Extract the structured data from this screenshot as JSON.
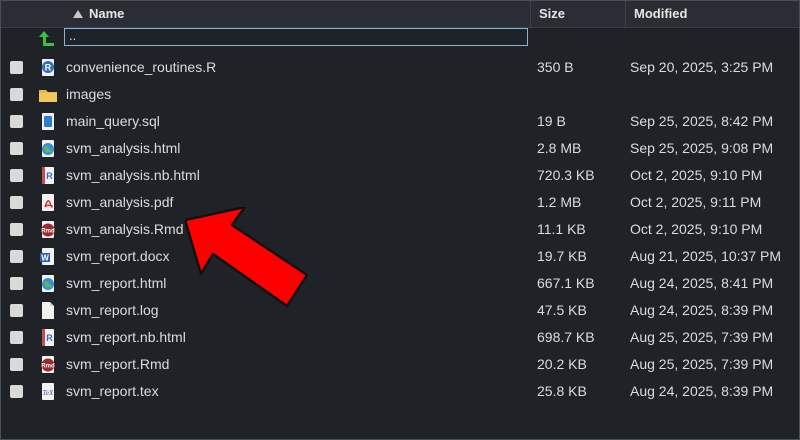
{
  "columns": {
    "name": "Name",
    "size": "Size",
    "modified": "Modified"
  },
  "parent_row": {
    "name": "..",
    "icon": "up-arrow-icon"
  },
  "files": [
    {
      "name": "convenience_routines.R",
      "size": "350 B",
      "modified": "Sep 20, 2025, 3:25 PM",
      "icon": "r-script-icon"
    },
    {
      "name": "images",
      "size": "",
      "modified": "",
      "icon": "folder-icon"
    },
    {
      "name": "main_query.sql",
      "size": "19 B",
      "modified": "Sep 25, 2025, 8:42 PM",
      "icon": "sql-file-icon"
    },
    {
      "name": "svm_analysis.html",
      "size": "2.8 MB",
      "modified": "Sep 25, 2025, 9:08 PM",
      "icon": "html-file-icon"
    },
    {
      "name": "svm_analysis.nb.html",
      "size": "720.3 KB",
      "modified": "Oct 2, 2025, 9:10 PM",
      "icon": "r-notebook-icon"
    },
    {
      "name": "svm_analysis.pdf",
      "size": "1.2 MB",
      "modified": "Oct 2, 2025, 9:11 PM",
      "icon": "pdf-file-icon"
    },
    {
      "name": "svm_analysis.Rmd",
      "size": "11.1 KB",
      "modified": "Oct 2, 2025, 9:10 PM",
      "icon": "rmd-file-icon"
    },
    {
      "name": "svm_report.docx",
      "size": "19.7 KB",
      "modified": "Aug 21, 2025, 10:37 PM",
      "icon": "word-file-icon"
    },
    {
      "name": "svm_report.html",
      "size": "667.1 KB",
      "modified": "Aug 24, 2025, 8:41 PM",
      "icon": "html-file-icon"
    },
    {
      "name": "svm_report.log",
      "size": "47.5 KB",
      "modified": "Aug 24, 2025, 8:39 PM",
      "icon": "text-file-icon"
    },
    {
      "name": "svm_report.nb.html",
      "size": "698.7 KB",
      "modified": "Aug 25, 2025, 7:39 PM",
      "icon": "r-notebook-icon"
    },
    {
      "name": "svm_report.Rmd",
      "size": "20.2 KB",
      "modified": "Aug 25, 2025, 7:39 PM",
      "icon": "rmd-file-icon"
    },
    {
      "name": "svm_report.tex",
      "size": "25.8 KB",
      "modified": "Aug 24, 2025, 8:39 PM",
      "icon": "tex-file-icon"
    }
  ],
  "annotation": {
    "type": "red-arrow",
    "color": "#ff0000",
    "points_to": "svm_analysis.Rmd"
  }
}
